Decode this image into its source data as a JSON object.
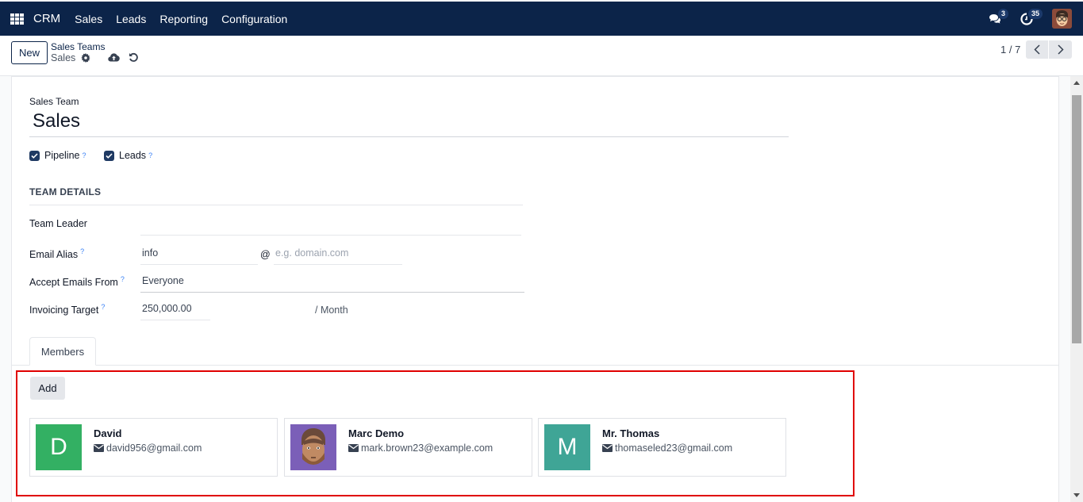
{
  "topbar": {
    "app_name": "CRM",
    "menu": [
      "Sales",
      "Leads",
      "Reporting",
      "Configuration"
    ],
    "messages_badge": "3",
    "activities_badge": "35",
    "icons": {
      "apps": "apps-grid-icon",
      "messages": "chat-icon",
      "activities": "clock-icon",
      "user": "user-avatar"
    }
  },
  "control_panel": {
    "new_label": "New",
    "breadcrumb_parent": "Sales Teams",
    "breadcrumb_current": "Sales",
    "pager_value": "1 / 7",
    "icons": {
      "settings": "gear-icon",
      "save": "cloud-upload-icon",
      "discard": "undo-icon",
      "prev": "chevron-left-icon",
      "next": "chevron-right-icon"
    }
  },
  "form": {
    "name_label": "Sales Team",
    "name_value": "Sales",
    "checkboxes": [
      {
        "label": "Pipeline",
        "checked": true,
        "help": "?"
      },
      {
        "label": "Leads",
        "checked": true,
        "help": "?"
      }
    ],
    "section_title": "TEAM DETAILS",
    "fields": {
      "team_leader": {
        "label": "Team Leader",
        "value": ""
      },
      "email_alias": {
        "label": "Email Alias",
        "help": "?",
        "value": "info",
        "at": "@",
        "domain_placeholder": "e.g. domain.com"
      },
      "accept_emails": {
        "label": "Accept Emails From",
        "help": "?",
        "value": "Everyone"
      },
      "invoicing_target": {
        "label": "Invoicing Target",
        "help": "?",
        "value": "250,000.00",
        "suffix": "/ Month"
      }
    },
    "tabs": [
      {
        "label": "Members",
        "active": true
      }
    ],
    "members": {
      "add_label": "Add",
      "list": [
        {
          "name": "David",
          "email": "david956@gmail.com",
          "initial": "D",
          "color": "#33b063",
          "avatar": "initial"
        },
        {
          "name": "Marc Demo",
          "email": "mark.brown23@example.com",
          "initial": "",
          "color": "#7b5fb8",
          "avatar": "photo"
        },
        {
          "name": "Mr. Thomas",
          "email": "thomaseled23@gmail.com",
          "initial": "M",
          "color": "#3fa596",
          "avatar": "initial"
        }
      ]
    }
  },
  "highlight_color": "#e00000"
}
